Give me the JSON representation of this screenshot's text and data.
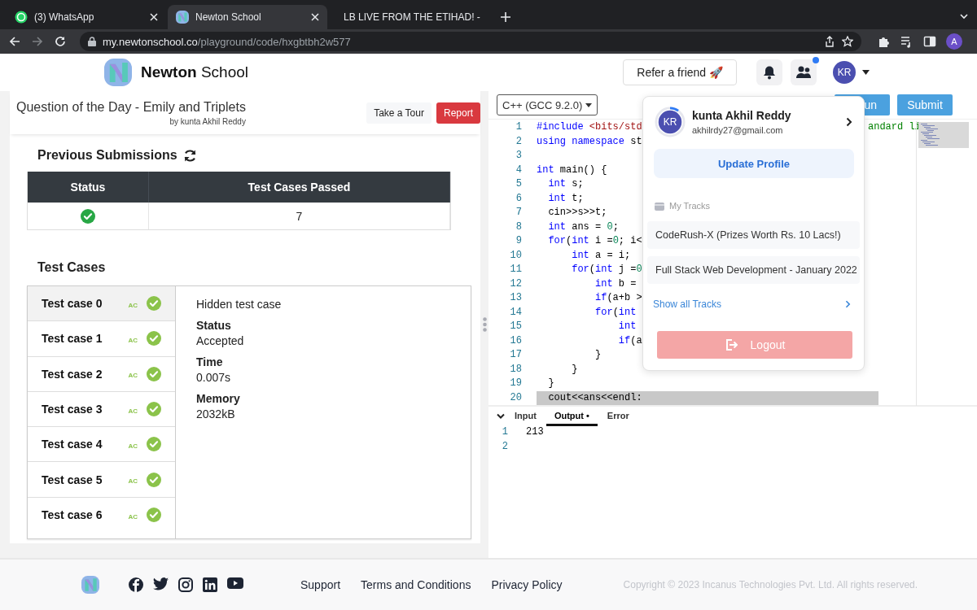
{
  "browser": {
    "tabs": [
      {
        "title": "(3) WhatsApp",
        "selected": false
      },
      {
        "title": "Newton School",
        "selected": true
      },
      {
        "title": "LB LIVE FROM THE ETIHAD! -",
        "selected": false
      }
    ],
    "url": "my.newtonschool.co/playground/code/hxgbtbh2w577",
    "profile": "A"
  },
  "header": {
    "brand": "**Newton** School",
    "refer_button": "Refer a friend 🚀",
    "notification_dot": true,
    "avatar": "KR"
  },
  "problem": {
    "title": "Question of the Day - Emily and Triplets",
    "author": "by kunta Akhil Reddy",
    "buttons": [
      {
        "label": "Take a Tour",
        "kind": "light"
      },
      {
        "label": "Report",
        "kind": "danger"
      }
    ]
  },
  "submissions": {
    "title": "Previous Submissions",
    "columns": [
      "Status",
      "Test Cases Passed"
    ],
    "rows": [
      {
        "passed": true,
        "count": "7"
      }
    ]
  },
  "test_cases": {
    "title": "Test Cases",
    "items": [
      {
        "label": "Test case 0",
        "verdict": "AC",
        "passed": true,
        "selected": true
      },
      {
        "label": "Test case 1",
        "verdict": "AC",
        "passed": true,
        "selected": false
      },
      {
        "label": "Test case 2",
        "verdict": "AC",
        "passed": true,
        "selected": false
      },
      {
        "label": "Test case 3",
        "verdict": "AC",
        "passed": true,
        "selected": false
      },
      {
        "label": "Test case 4",
        "verdict": "AC",
        "passed": true,
        "selected": false
      },
      {
        "label": "Test case 5",
        "verdict": "AC",
        "passed": true,
        "selected": false
      },
      {
        "label": "Test case 6",
        "verdict": "AC",
        "passed": true,
        "selected": false
      }
    ],
    "detail": {
      "heading": "Hidden test case",
      "fields": [
        {
          "label": "Status",
          "value": "Accepted"
        },
        {
          "label": "Time",
          "value": "0.007s"
        },
        {
          "label": "Memory",
          "value": "2032kB"
        }
      ]
    }
  },
  "editor": {
    "language": "C++ (GCC 9.2.0)",
    "buttons": [
      {
        "label": "un",
        "kind": "run"
      },
      {
        "label": "Submit",
        "kind": "submit"
      }
    ],
    "lines": [
      {
        "number": "1",
        "highlighted": false,
        "tokens": [
          {
            "text": "#include ",
            "kind": "keyword"
          },
          {
            "text": "<bits/std",
            "kind": "string"
          }
        ],
        "tail": [
          {
            "text": "andard li",
            "kind": "comment"
          }
        ]
      },
      {
        "number": "2",
        "highlighted": false,
        "tokens": [
          {
            "text": "using namespace ",
            "kind": "keyword"
          },
          {
            "text": "st",
            "kind": "plain"
          }
        ]
      },
      {
        "number": "3",
        "highlighted": false
      },
      {
        "number": "4",
        "highlighted": false,
        "tokens": [
          {
            "text": "int",
            "kind": "keyword"
          },
          {
            "text": " main() {",
            "kind": "plain"
          }
        ]
      },
      {
        "number": "5",
        "highlighted": false,
        "tokens": [
          {
            "text": "  int",
            "kind": "keyword"
          },
          {
            "text": " s;",
            "kind": "plain"
          }
        ]
      },
      {
        "number": "6",
        "highlighted": false,
        "tokens": [
          {
            "text": "  int",
            "kind": "keyword"
          },
          {
            "text": " t;",
            "kind": "plain"
          }
        ]
      },
      {
        "number": "7",
        "highlighted": false,
        "tokens": [
          {
            "text": "  cin>>s>>t;",
            "kind": "plain"
          }
        ]
      },
      {
        "number": "8",
        "highlighted": false,
        "tokens": [
          {
            "text": "  int",
            "kind": "keyword"
          },
          {
            "text": " ans = ",
            "kind": "plain"
          },
          {
            "text": "0",
            "kind": "number"
          },
          {
            "text": ";",
            "kind": "plain"
          }
        ]
      },
      {
        "number": "9",
        "highlighted": false,
        "tokens": [
          {
            "text": "  for",
            "kind": "keyword"
          },
          {
            "text": "(",
            "kind": "plain"
          },
          {
            "text": "int",
            "kind": "keyword"
          },
          {
            "text": " i =",
            "kind": "plain"
          },
          {
            "text": "0",
            "kind": "number"
          },
          {
            "text": "; i<",
            "kind": "plain"
          }
        ]
      },
      {
        "number": "10",
        "highlighted": false,
        "tokens": [
          {
            "text": "      int",
            "kind": "keyword"
          },
          {
            "text": " a = i;",
            "kind": "plain"
          }
        ]
      },
      {
        "number": "11",
        "highlighted": false,
        "tokens": [
          {
            "text": "      for",
            "kind": "keyword"
          },
          {
            "text": "(",
            "kind": "plain"
          },
          {
            "text": "int",
            "kind": "keyword"
          },
          {
            "text": " j =",
            "kind": "plain"
          },
          {
            "text": "0",
            "kind": "number"
          }
        ]
      },
      {
        "number": "12",
        "highlighted": false,
        "tokens": [
          {
            "text": "          int",
            "kind": "keyword"
          },
          {
            "text": " b =",
            "kind": "plain"
          }
        ]
      },
      {
        "number": "13",
        "highlighted": false,
        "tokens": [
          {
            "text": "          if",
            "kind": "keyword"
          },
          {
            "text": "(a+b >",
            "kind": "plain"
          }
        ]
      },
      {
        "number": "14",
        "highlighted": false,
        "tokens": [
          {
            "text": "          for",
            "kind": "keyword"
          },
          {
            "text": "(",
            "kind": "plain"
          },
          {
            "text": "int",
            "kind": "keyword"
          }
        ]
      },
      {
        "number": "15",
        "highlighted": false,
        "tokens": [
          {
            "text": "              int",
            "kind": "keyword"
          }
        ]
      },
      {
        "number": "16",
        "highlighted": false,
        "tokens": [
          {
            "text": "              if",
            "kind": "keyword"
          },
          {
            "text": "(a",
            "kind": "plain"
          }
        ]
      },
      {
        "number": "17",
        "highlighted": false,
        "tokens": [
          {
            "text": "          }",
            "kind": "plain"
          }
        ]
      },
      {
        "number": "18",
        "highlighted": false,
        "tokens": [
          {
            "text": "      }",
            "kind": "plain"
          }
        ]
      },
      {
        "number": "19",
        "highlighted": false,
        "tokens": [
          {
            "text": "  }",
            "kind": "plain"
          }
        ]
      },
      {
        "number": "20",
        "highlighted": true,
        "tokens": [
          {
            "text": "  cout<<ans<<endl:",
            "kind": "plain"
          }
        ]
      }
    ]
  },
  "console": {
    "tabs": [
      {
        "label": "Input",
        "selected": false
      },
      {
        "label": "Output •",
        "selected": true
      },
      {
        "label": "Error",
        "selected": false
      }
    ],
    "lines": [
      {
        "number": "1",
        "text": "213"
      },
      {
        "number": "2"
      }
    ]
  },
  "profile_menu": {
    "avatar": "KR",
    "name": "kunta Akhil Reddy",
    "email": "akhilrdy27@gmail.com",
    "update_button": "Update Profile",
    "tracks_heading": "My Tracks",
    "tracks": [
      "CodeRush-X (Prizes Worth Rs. 10 Lacs!)",
      "Full Stack Web Development - January 2022"
    ],
    "show_all": "Show all Tracks",
    "logout": {
      "label": "Logout",
      "disabled": true
    }
  },
  "footer": {
    "social": [
      {
        "kind": "facebook"
      },
      {
        "kind": "twitter"
      },
      {
        "kind": "instagram"
      },
      {
        "kind": "linkedin"
      },
      {
        "kind": "youtube"
      }
    ],
    "links": [
      "Support",
      "Terms and Conditions",
      "Privacy Policy"
    ],
    "copyright": "Copyright © 2023 Incanus Technologies Pvt. Ltd. All rights reserved."
  }
}
